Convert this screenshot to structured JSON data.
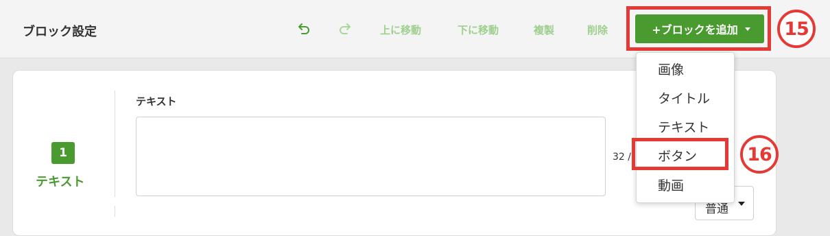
{
  "header": {
    "title": "ブロック設定",
    "undo_icon": "undo-icon",
    "redo_icon": "redo-icon",
    "move_up_label": "上に移動",
    "move_down_label": "下に移動",
    "duplicate_label": "複製",
    "delete_label": "削除",
    "add_block_label": "+ブロックを追加",
    "add_block_caret": "chevron-down-icon"
  },
  "annotations": {
    "step_15": "15",
    "step_16": "16"
  },
  "dropdown": {
    "items": [
      {
        "label": "画像"
      },
      {
        "label": "タイトル"
      },
      {
        "label": "テキスト"
      },
      {
        "label": "ボタン"
      },
      {
        "label": "動画"
      }
    ]
  },
  "block": {
    "number": "1",
    "type_label": "テキスト",
    "field_label": "テキスト",
    "text_value": "",
    "char_count": "32 /",
    "size_value": "普通"
  },
  "colors": {
    "accent_green": "#4a9b2f",
    "disabled_green": "#9fcf8f",
    "annotation_red": "#e53935"
  }
}
